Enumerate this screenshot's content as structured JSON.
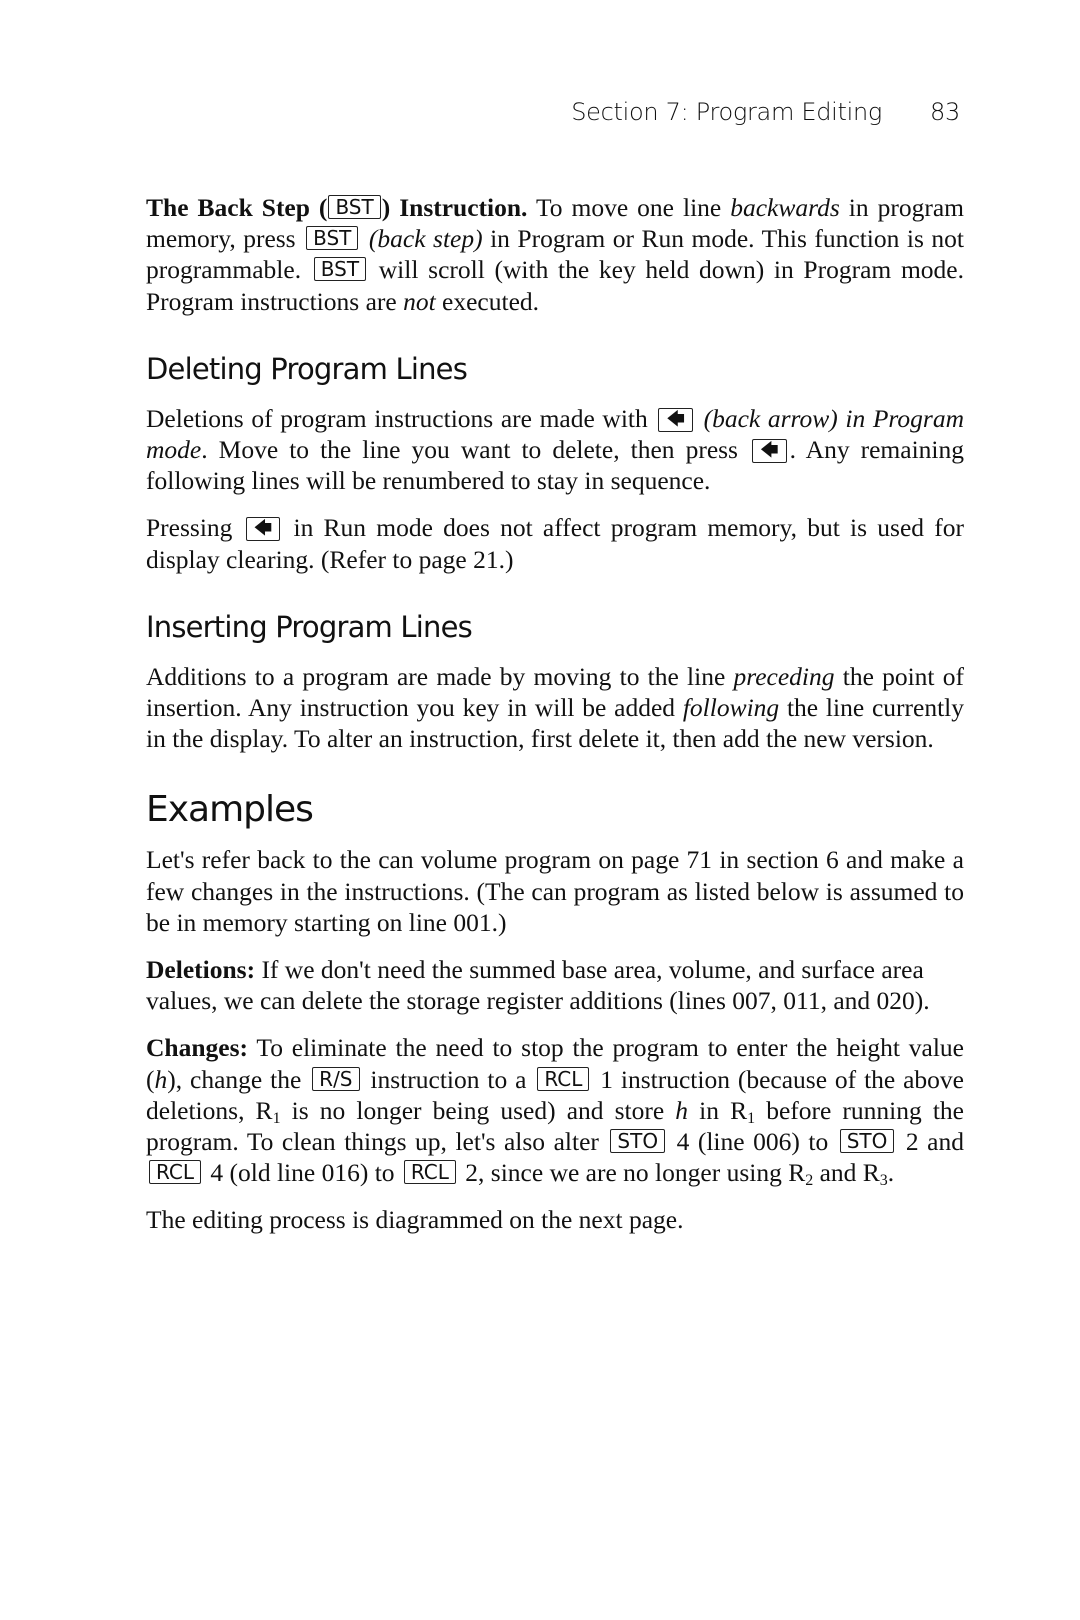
{
  "header": {
    "section": "Section 7: Program Editing",
    "page_number": "83"
  },
  "back_step": {
    "title": "The Back Step (",
    "key": "BST",
    "title_end": ") Instruction.",
    "t1": " To move one line ",
    "t1_i": "backwards",
    "t2": " in program memory, press ",
    "key2": "BST",
    "t3_i": " (back step)",
    "t4": " in Program or Run mode. This function is not programmable. ",
    "key3": "BST",
    "t5": " will scroll (with the key held down) in Program mode. Program instructions are ",
    "t5_i": "not",
    "t6": " executed."
  },
  "deleting": {
    "heading": "Deleting Program Lines",
    "p1_a": "Deletions of program instructions are made with ",
    "arrow_key": "back-arrow-key",
    "p1_b_i": " (back arrow) in Program mode",
    "p1_c": ". Move to the line you want to delete, then press ",
    "p1_d": ". Any remaining following lines will be renumbered to stay in sequence.",
    "p2_a": "Pressing ",
    "p2_b": " in Run mode does not affect program memory, but is used for display clearing. (Refer to page 21.)"
  },
  "inserting": {
    "heading": "Inserting Program Lines",
    "p_a": "Additions to a program are made by moving to the line ",
    "p_b_i": "preceding",
    "p_c": " the point of insertion. Any instruction you key in will be added ",
    "p_d_i": "following",
    "p_e": " the line currently in the display. To alter an instruction, first delete it, then add the new version."
  },
  "examples": {
    "heading": "Examples",
    "intro": "Let's refer back to the can volume program on page 71 in section 6 and make a few changes in the instructions. (The can program as listed below is assumed to be in memory starting on line 001.)",
    "deletions_label": "Deletions:",
    "deletions_text": " If we don't need the summed base area, volume, and surface area values, we can delete the storage register additions (lines 007, 011, and 020).",
    "changes_label": "Changes:",
    "c1": " To eliminate the need to stop the program to enter the height value (",
    "c1_i": "h",
    "c2": "), change the ",
    "key_rs": "R/S",
    "c3": " instruction to a ",
    "key_rcl": "RCL",
    "c4": " 1 instruction (because of the above deletions, R",
    "sub1": "1",
    "c5": " is no longer being used) and store ",
    "c5_i": "h",
    "c6": " in R",
    "sub2": "1",
    "c7": " before running the program. To clean things up, let's also alter ",
    "key_sto": "STO",
    "c8": " 4 (line 006) to ",
    "c9": " 2 and ",
    "c10": " 4 (old line 016) to ",
    "c11": " 2, since we are no longer using R",
    "sub3": "2",
    "c12": " and R",
    "sub4": "3",
    "c13": ".",
    "closing": "The editing process is diagrammed on the next page."
  }
}
